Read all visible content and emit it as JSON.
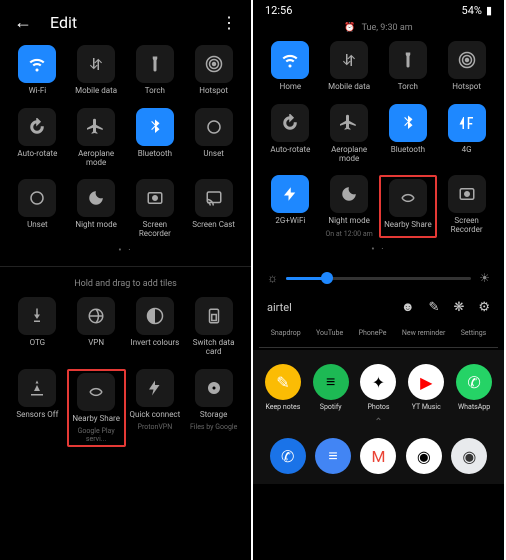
{
  "left": {
    "title": "Edit",
    "rows": [
      [
        {
          "l": "Wi-Fi",
          "on": true,
          "ic": "wifi"
        },
        {
          "l": "Mobile data",
          "ic": "data"
        },
        {
          "l": "Torch",
          "ic": "torch"
        },
        {
          "l": "Hotspot",
          "ic": "hotspot"
        }
      ],
      [
        {
          "l": "Auto-rotate",
          "ic": "rotate"
        },
        {
          "l": "Aeroplane mode",
          "ic": "plane"
        },
        {
          "l": "Bluetooth",
          "on": true,
          "ic": "bt"
        },
        {
          "l": "Unset",
          "ic": "q"
        }
      ],
      [
        {
          "l": "Unset",
          "ic": "q"
        },
        {
          "l": "Night mode",
          "ic": "moon"
        },
        {
          "l": "Screen Recorder",
          "ic": "rec"
        },
        {
          "l": "Screen Cast",
          "ic": "cast"
        }
      ]
    ],
    "hint": "Hold and drag to add tiles",
    "rows2": [
      [
        {
          "l": "OTG",
          "ic": "otg"
        },
        {
          "l": "VPN",
          "ic": "vpn"
        },
        {
          "l": "Invert colours",
          "ic": "invert"
        },
        {
          "l": "Switch data card",
          "ic": "sim"
        }
      ],
      [
        {
          "l": "Sensors Off",
          "ic": "sensor"
        },
        {
          "l": "Nearby Share",
          "sub": "Google Play servi...",
          "ic": "nearby",
          "hl": true
        },
        {
          "l": "Quick connect",
          "sub": "ProtonVPN",
          "ic": "qc"
        },
        {
          "l": "Storage",
          "sub": "Files by Google",
          "ic": "storage"
        }
      ]
    ]
  },
  "right": {
    "time": "12:56",
    "battery": "54%",
    "subtime": "Tue, 9:30 am",
    "rows": [
      [
        {
          "l": "Home",
          "on": true,
          "ic": "wifi"
        },
        {
          "l": "Mobile data",
          "ic": "data"
        },
        {
          "l": "Torch",
          "ic": "torch"
        },
        {
          "l": "Hotspot",
          "ic": "hotspot"
        }
      ],
      [
        {
          "l": "Auto-rotate",
          "ic": "rotate"
        },
        {
          "l": "Aeroplane mode",
          "ic": "plane"
        },
        {
          "l": "Bluetooth",
          "on": true,
          "ic": "bt"
        },
        {
          "l": "4G",
          "on": true,
          "ic": "4g"
        }
      ],
      [
        {
          "l": "2G+WiFi",
          "on": true,
          "ic": "2g"
        },
        {
          "l": "Night mode",
          "sub": "On at 12:00 am",
          "ic": "moon"
        },
        {
          "l": "Nearby Share",
          "ic": "nearby",
          "hl": true
        },
        {
          "l": "Screen Recorder",
          "ic": "rec"
        }
      ]
    ],
    "carrier": "airtel",
    "notif": [
      "Snapdrop",
      "YouTube",
      "PhonePe",
      "New reminder",
      "Settings"
    ],
    "apps": [
      {
        "l": "Keep notes",
        "bg": "#fbbc04",
        "fg": "#fff",
        "g": "✎"
      },
      {
        "l": "Spotify",
        "bg": "#1db954",
        "fg": "#000",
        "g": "≡"
      },
      {
        "l": "Photos",
        "bg": "#fff",
        "fg": "#000",
        "g": "✦"
      },
      {
        "l": "YT Music",
        "bg": "#fff",
        "fg": "#f00",
        "g": "▶"
      },
      {
        "l": "WhatsApp",
        "bg": "#25d366",
        "fg": "#fff",
        "g": "✆"
      }
    ],
    "dock": [
      {
        "bg": "#1a73e8",
        "fg": "#fff",
        "g": "✆"
      },
      {
        "bg": "#4285f4",
        "fg": "#fff",
        "g": "≡"
      },
      {
        "bg": "#fff",
        "fg": "#ea4335",
        "g": "M"
      },
      {
        "bg": "#fff",
        "fg": "#000",
        "g": "◉"
      },
      {
        "bg": "#e8eaed",
        "fg": "#333",
        "g": "◉"
      }
    ]
  }
}
